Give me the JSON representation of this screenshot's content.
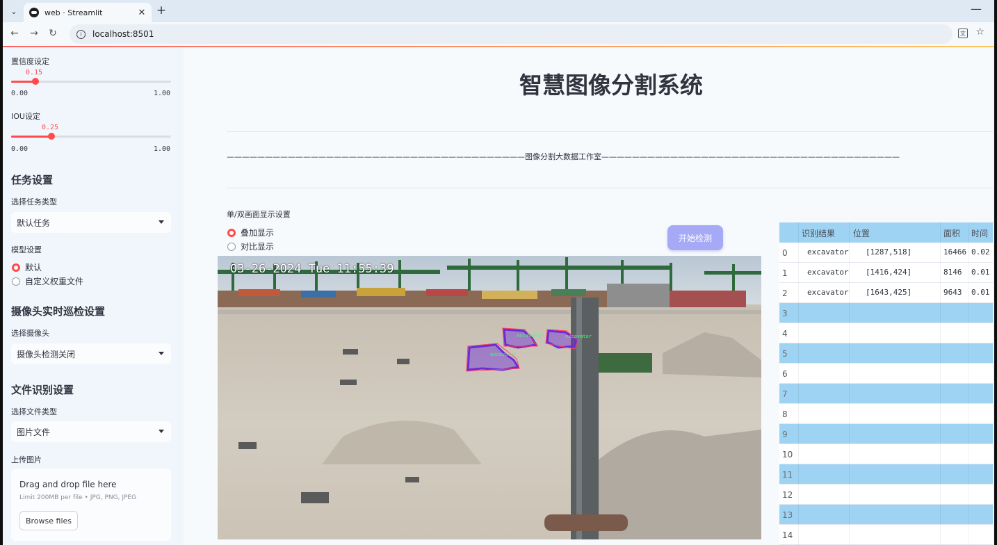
{
  "browser": {
    "tab_title": "web · Streamlit",
    "url": "localhost:8501"
  },
  "sidebar": {
    "confidence": {
      "label": "置信度设定",
      "value": "0.15",
      "value_fraction": 0.15,
      "min": "0.00",
      "max": "1.00"
    },
    "iou": {
      "label": "IOU设定",
      "value": "0.25",
      "value_fraction": 0.25,
      "min": "0.00",
      "max": "1.00"
    },
    "task_heading": "任务设置",
    "task_type_label": "选择任务类型",
    "task_type_value": "默认任务",
    "model_label": "模型设置",
    "model_options": [
      "默认",
      "自定义权重文件"
    ],
    "model_selected": "默认",
    "camera_heading": "摄像头实时巡检设置",
    "camera_label": "选择摄像头",
    "camera_value": "摄像头检测关闭",
    "file_heading": "文件识别设置",
    "file_type_label": "选择文件类型",
    "file_type_value": "图片文件",
    "upload_label": "上传图片",
    "upload_title": "Drag and drop file here",
    "upload_limit": "Limit 200MB per file • JPG, PNG, JPEG",
    "browse_label": "Browse files"
  },
  "main": {
    "title": "智慧图像分割系统",
    "studio_line": "———————————————————————————————————————图像分割大数据工作室———————————————————————————————————————",
    "display_mode_label": "单/双画面显示设置",
    "display_options": [
      "叠加显示",
      "对比显示"
    ],
    "display_selected": "叠加显示",
    "start_button": "开始检测",
    "image": {
      "timestamp": "03-26-2024 Tue 11:55:39",
      "detection_labels": [
        "excavator",
        "excavator",
        "excavator"
      ]
    }
  },
  "results_table": {
    "columns": [
      "识别结果",
      "位置",
      "面积",
      "时间"
    ],
    "rows": [
      {
        "index": "0",
        "result": "excavator",
        "position": "[1287,518]",
        "area": "16466",
        "time": "0.02"
      },
      {
        "index": "1",
        "result": "excavator",
        "position": "[1416,424]",
        "area": "8146",
        "time": "0.01"
      },
      {
        "index": "2",
        "result": "excavator",
        "position": "[1643,425]",
        "area": "9643",
        "time": "0.01"
      },
      {
        "index": "3"
      },
      {
        "index": "4"
      },
      {
        "index": "5"
      },
      {
        "index": "6"
      },
      {
        "index": "7"
      },
      {
        "index": "8"
      },
      {
        "index": "9"
      },
      {
        "index": "10"
      },
      {
        "index": "11"
      },
      {
        "index": "12"
      },
      {
        "index": "13"
      },
      {
        "index": "14"
      }
    ]
  },
  "colors": {
    "accent": "#ff4b4b",
    "table_header": "#9fd3f3",
    "button": "#a5a9f6",
    "mask": "#6b2bd6"
  }
}
